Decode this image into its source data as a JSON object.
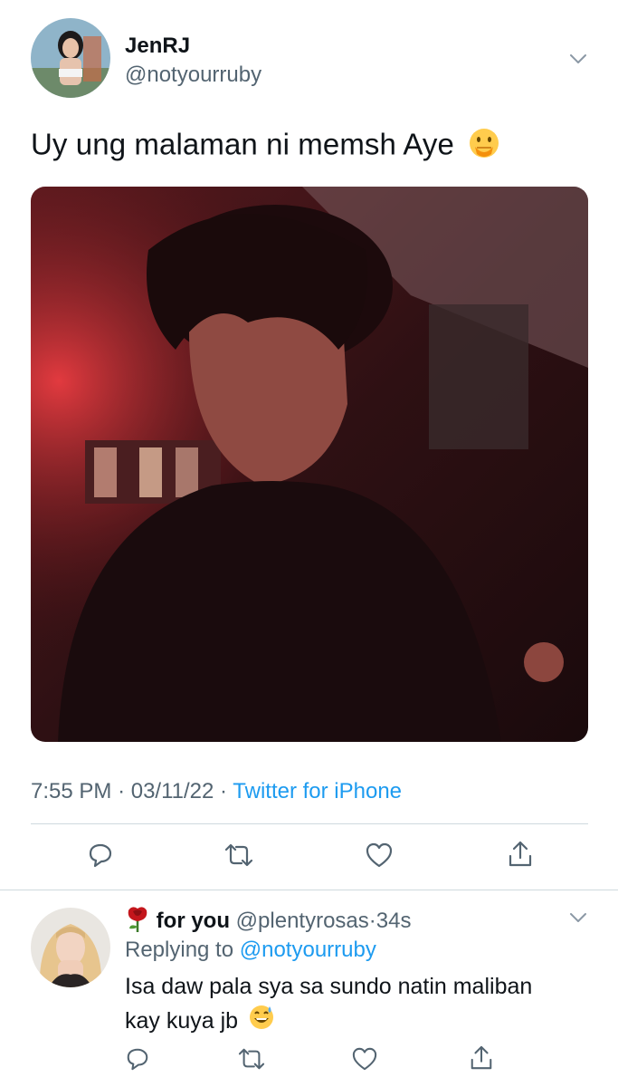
{
  "tweet": {
    "author_name": "JenRJ",
    "author_handle": "@notyourruby",
    "text": "Uy ung malaman ni memsh Aye",
    "text_emoji": "face-with-hand-over-mouth",
    "time": "7:55 PM",
    "separator": "·",
    "date": "03/11/22",
    "source": "Twitter for iPhone"
  },
  "reply": {
    "emoji_prefix": "rose",
    "author_name": "for you",
    "author_handle": "@plentyrosas",
    "separator": "·",
    "age": "34s",
    "replying_label": "Replying to",
    "replying_handle": "@notyourruby",
    "text_line1": "Isa daw pala sya sa sundo natin maliban",
    "text_line2": "kay kuya jb",
    "text_emoji": "grinning-face-with-sweat"
  },
  "colors": {
    "link": "#1d9bf0",
    "secondary_text": "#536471",
    "divider": "#cfd9de"
  },
  "icons": [
    "reply-icon",
    "retweet-icon",
    "like-icon",
    "share-icon",
    "chevron-down-icon"
  ]
}
